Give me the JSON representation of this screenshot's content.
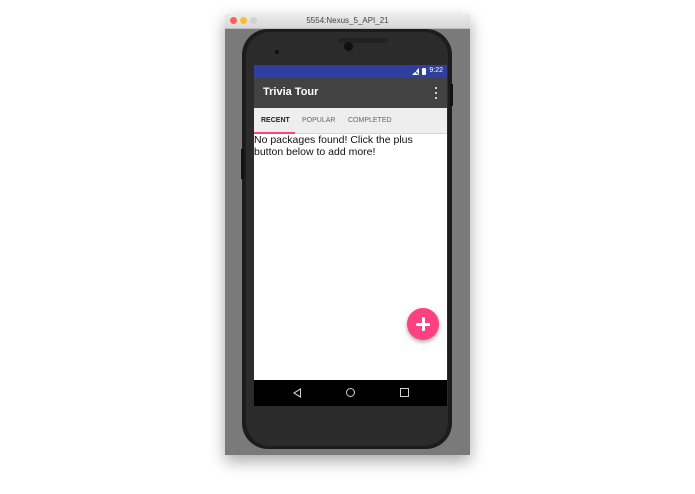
{
  "window": {
    "title": "5554:Nexus_5_API_21"
  },
  "status_bar": {
    "time": "9:22"
  },
  "app_bar": {
    "title": "Trivia Tour"
  },
  "tabs": [
    {
      "label": "RECENT",
      "active": true
    },
    {
      "label": "POPULAR",
      "active": false
    },
    {
      "label": "COMPLETED",
      "active": false
    }
  ],
  "content": {
    "empty_message": "No packages found! Click the plus button below to add more!"
  },
  "fab": {
    "icon": "plus-icon"
  },
  "nav_bar": {
    "icons": [
      "back-icon",
      "home-icon",
      "recents-icon"
    ]
  },
  "colors": {
    "status_bar": "#303f9f",
    "app_bar": "#424242",
    "accent": "#ff4081",
    "tab_bar": "#eeeeee"
  }
}
